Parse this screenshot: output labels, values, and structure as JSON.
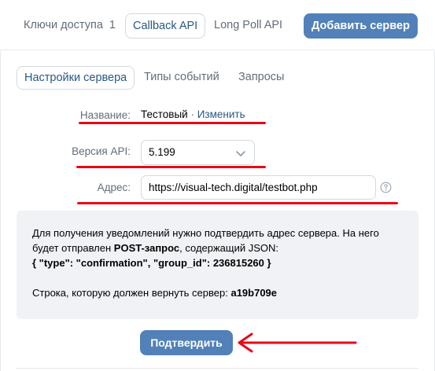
{
  "topbar": {
    "tabs": [
      {
        "label": "Ключи доступа",
        "count": "1"
      },
      {
        "label": "Callback API"
      },
      {
        "label": "Long Poll API"
      }
    ],
    "add_server_label": "Добавить сервер"
  },
  "subtabs": [
    {
      "label": "Настройки сервера"
    },
    {
      "label": "Типы событий"
    },
    {
      "label": "Запросы"
    }
  ],
  "form": {
    "name_label": "Название:",
    "name_value": "Тестовый",
    "name_separator": " · ",
    "name_change": "Изменить",
    "api_version_label": "Версия API:",
    "api_version_value": "5.199",
    "address_label": "Адрес:",
    "address_value": "https://visual-tech.digital/testbot.php"
  },
  "info": {
    "line1": "Для получения уведомлений нужно подтвердить адрес сервера. На него",
    "line2_prefix": "будет отправлен ",
    "line2_bold": "POST-запрос",
    "line2_suffix": ", содержащий JSON:",
    "json_line": "{ \"type\": \"confirmation\", \"group_id\": 236815260 }",
    "return_prefix": "Строка, которую должен вернуть сервер: ",
    "return_value": "a19b709e"
  },
  "confirm_label": "Подтвердить",
  "colors": {
    "accent": "#5181b8",
    "link": "#2a5885",
    "annotation_red": "#e60a17",
    "info_bg": "#f0f2f5"
  }
}
